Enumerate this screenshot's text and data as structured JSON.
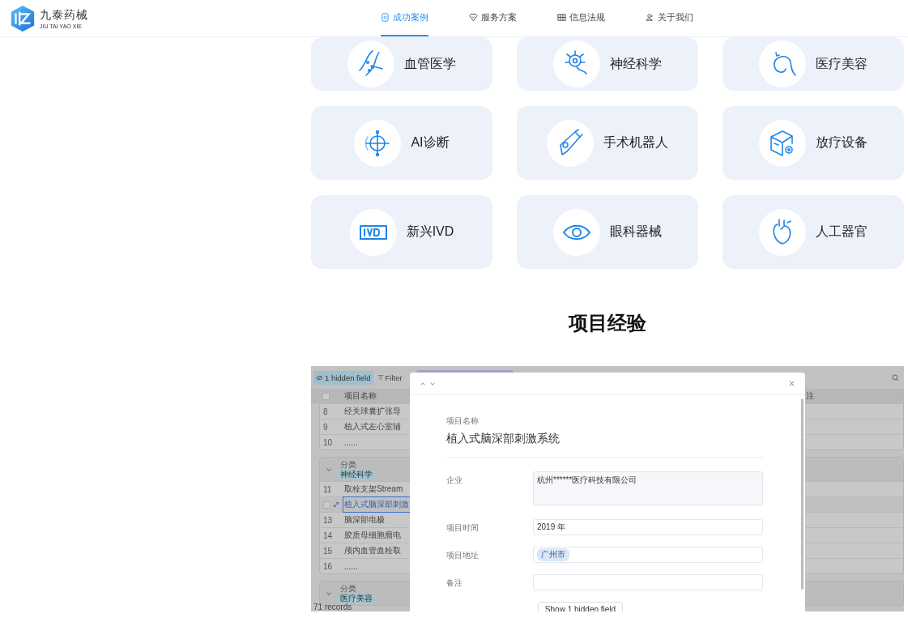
{
  "brand": {
    "name": "九泰药械",
    "subtitle": "JIU TAI YAO XIE"
  },
  "nav": [
    {
      "label": "成功案例",
      "selected": true
    },
    {
      "label": "服务方案",
      "selected": false
    },
    {
      "label": "信息法规",
      "selected": false
    },
    {
      "label": "关于我们",
      "selected": false
    }
  ],
  "categories": [
    "血管医学",
    "神经科学",
    "医疗美容",
    "AI诊断",
    "手术机器人",
    "放疗设备",
    "新兴IVD",
    "眼科器械",
    "人工器官"
  ],
  "section_title": "项目经验",
  "embed": {
    "toolbar": {
      "hidden_fields": "1 hidden field",
      "filter": "Filter"
    },
    "columns": [
      "项目名称",
      "注"
    ],
    "groups": [
      {
        "rows": [
          {
            "number": "8",
            "name": "经关球囊扩张导",
            "selected": false
          },
          {
            "number": "9",
            "name": "植入式左心室辅",
            "selected": false
          },
          {
            "number": "10",
            "name": "......",
            "selected": false
          }
        ]
      },
      {
        "caption": "分类",
        "tag": "神经科学",
        "rows": [
          {
            "number": "11",
            "name": "取栓支架Stream",
            "selected": false
          },
          {
            "name": "植入式脑深部刺激",
            "selected": true,
            "checked": false
          },
          {
            "number": "13",
            "name": "脑深部电极",
            "selected": false
          },
          {
            "number": "14",
            "name": "胶质母细胞瘤电",
            "selected": false
          },
          {
            "number": "15",
            "name": "颅内血管血栓取",
            "selected": false
          },
          {
            "number": "16",
            "name": "......",
            "selected": false
          }
        ]
      },
      {
        "caption": "分类",
        "tag": "医疗美容"
      }
    ],
    "header_checked": false,
    "footer": "71 records",
    "modal": {
      "title_label": "项目名称",
      "title": "植入式脑深部刺激系统",
      "fields": [
        {
          "label": "企业",
          "kind": "textarea",
          "value": "杭州******医疗科技有限公司"
        },
        {
          "label": "项目时间",
          "kind": "text",
          "value": "2019 年"
        },
        {
          "label": "项目地址",
          "kind": "tag",
          "value": "广州市"
        },
        {
          "label": "备注",
          "kind": "text"
        }
      ],
      "button": "Show 1 hidden field"
    }
  }
}
